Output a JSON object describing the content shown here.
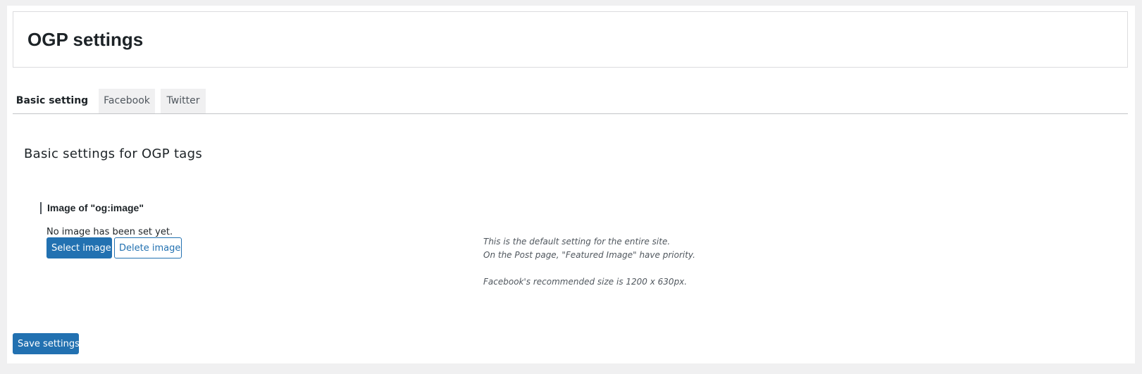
{
  "page": {
    "title": "OGP settings"
  },
  "tabs": [
    {
      "label": "Basic setting",
      "active": true
    },
    {
      "label": "Facebook",
      "active": false
    },
    {
      "label": "Twitter",
      "active": false
    }
  ],
  "section": {
    "title": "Basic settings for OGP tags"
  },
  "og_image": {
    "label": "Image of \"og:image\"",
    "status_text": "No image has been set yet.",
    "select_button": "Select image",
    "delete_button": "Delete image"
  },
  "help": {
    "line1": "This is the default setting for the entire site.",
    "line2": "On the Post page, \"Featured Image\" have priority.",
    "line3": "Facebook's recommended size is 1200 x 630px."
  },
  "footer": {
    "save_button": "Save settings"
  },
  "colors": {
    "primary": "#2271b1",
    "background": "#f0f0f1",
    "panel": "#ffffff",
    "text": "#1d2327",
    "muted_text": "#50575e"
  }
}
